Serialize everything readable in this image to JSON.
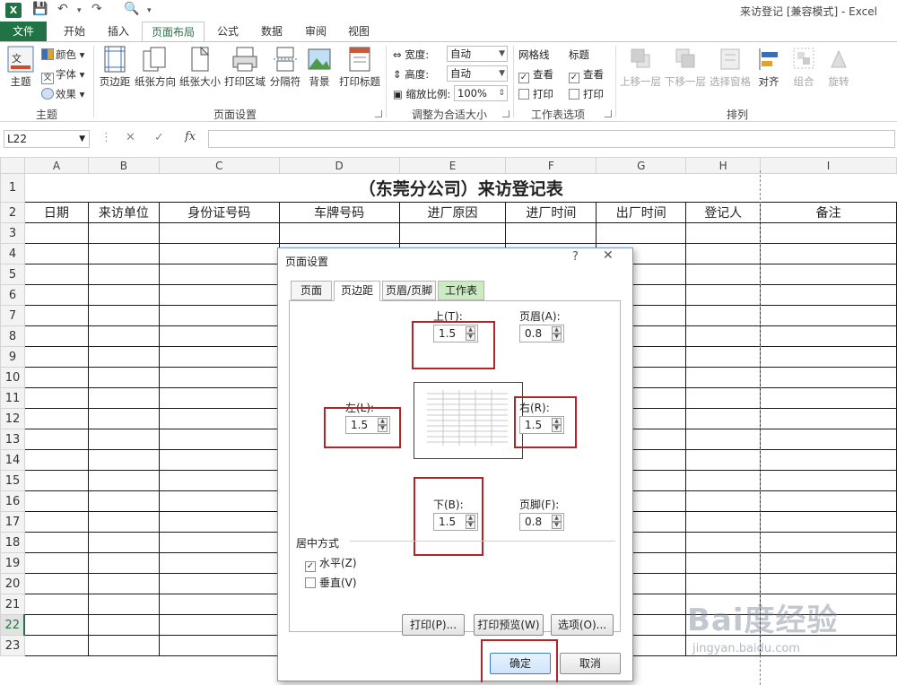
{
  "window": {
    "title": "来访登记 [兼容模式] - Excel",
    "app_logo": "X"
  },
  "quick_access": {
    "save": "💾",
    "undo": "↶",
    "redo": "↷",
    "preview": "🔍"
  },
  "tabs": [
    {
      "label": "文件"
    },
    {
      "label": "开始"
    },
    {
      "label": "插入"
    },
    {
      "label": "页面布局"
    },
    {
      "label": "公式"
    },
    {
      "label": "数据"
    },
    {
      "label": "审阅"
    },
    {
      "label": "视图"
    }
  ],
  "ribbon": {
    "theme": {
      "main": "主题",
      "colors": "颜色",
      "fonts": "字体",
      "effects": "效果",
      "group": "主题"
    },
    "page_setup": {
      "buttons": [
        "页边距",
        "纸张方向",
        "纸张大小",
        "打印区域",
        "分隔符",
        "背景",
        "打印标题"
      ],
      "group": "页面设置"
    },
    "scale": {
      "width_label": "宽度:",
      "width_value": "自动",
      "height_label": "高度:",
      "height_value": "自动",
      "scale_label": "缩放比例:",
      "scale_value": "100%",
      "group": "调整为合适大小"
    },
    "sheet_options": {
      "gridlines": "网格线",
      "headings": "标题",
      "view": "查看",
      "print": "打印",
      "group": "工作表选项"
    },
    "arrange": {
      "buttons": [
        "上移一层",
        "下移一层",
        "选择窗格",
        "对齐",
        "组合",
        "旋转"
      ],
      "group": "排列"
    }
  },
  "formula_bar": {
    "name_box": "L22",
    "cancel": "✕",
    "enter": "✓",
    "fx": "fx",
    "value": ""
  },
  "grid": {
    "columns": [
      "A",
      "B",
      "C",
      "D",
      "E",
      "F",
      "G",
      "H",
      "I"
    ],
    "title": "（东莞分公司）来访登记表",
    "headers": [
      "日期",
      "来访单位",
      "身份证号码",
      "车牌号码",
      "进厂原因",
      "进厂时间",
      "出厂时间",
      "登记人",
      "备注"
    ],
    "rows": [
      "1",
      "2",
      "3",
      "4",
      "5",
      "6",
      "7",
      "8",
      "9",
      "10",
      "11",
      "12",
      "13",
      "14",
      "15",
      "16",
      "17",
      "18",
      "19",
      "20",
      "21",
      "22",
      "23"
    ],
    "selected_row": "22"
  },
  "dialog": {
    "title": "页面设置",
    "help": "?",
    "close": "✕",
    "tabs": [
      "页面",
      "页边距",
      "页眉/页脚",
      "工作表"
    ],
    "active_tab": "页边距",
    "top": {
      "label": "上(T):",
      "value": "1.5"
    },
    "header": {
      "label": "页眉(A):",
      "value": "0.8"
    },
    "left": {
      "label": "左(L):",
      "value": "1.5"
    },
    "right": {
      "label": "右(R):",
      "value": "1.5"
    },
    "bottom": {
      "label": "下(B):",
      "value": "1.5"
    },
    "footer": {
      "label": "页脚(F):",
      "value": "0.8"
    },
    "center_section": "居中方式",
    "horizontal": {
      "label": "水平(Z)",
      "checked": true
    },
    "vertical": {
      "label": "垂直(V)",
      "checked": false
    },
    "print_btn": "打印(P)...",
    "preview_btn": "打印预览(W)",
    "options_btn": "选项(O)...",
    "ok_btn": "确定",
    "cancel_btn": "取消"
  },
  "watermark": {
    "logo": "Bai度经验",
    "url": "jingyan.baidu.com"
  },
  "colors": {
    "excel_green": "#217346",
    "highlight_red": "#b0252a"
  }
}
